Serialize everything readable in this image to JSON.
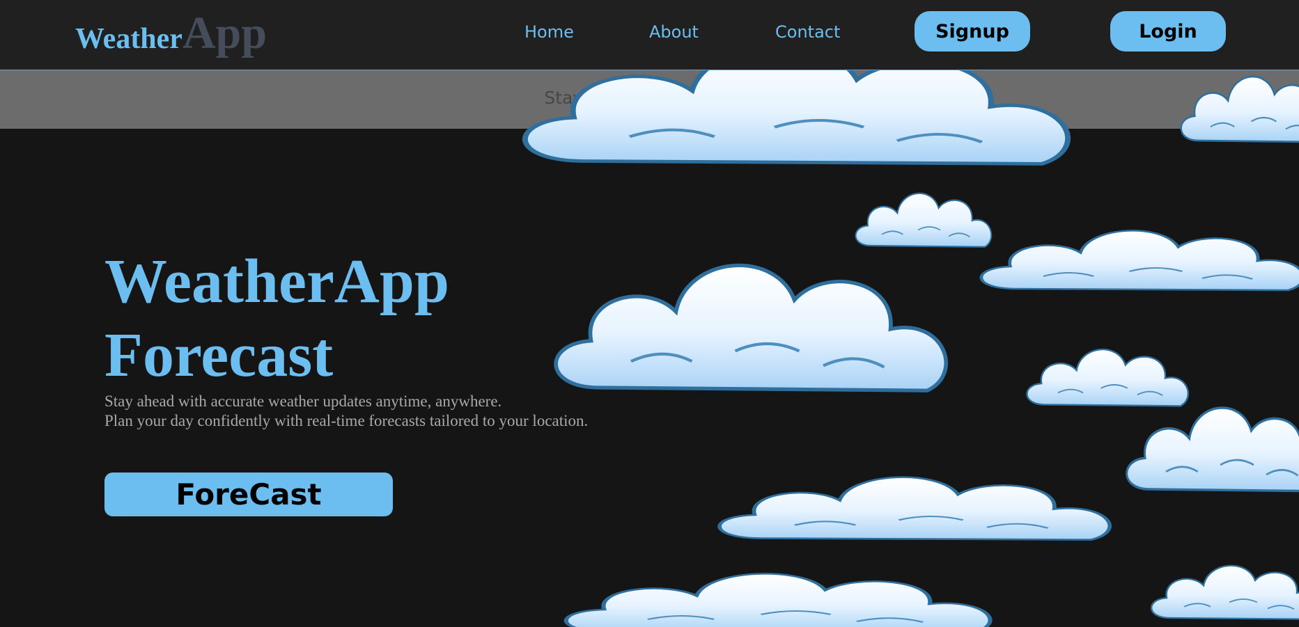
{
  "header": {
    "logo_first": "Weather",
    "logo_second": "App",
    "nav": [
      "Home",
      "About",
      "Contact"
    ],
    "signup_label": "Signup",
    "login_label": "Login"
  },
  "banner": {
    "text": "Stay Connected With Us"
  },
  "hero": {
    "title_line1": "WeatherApp",
    "title_line2": "Forecast",
    "subtitle_line1": "Stay ahead with accurate weather updates anytime, anywhere.",
    "subtitle_line2": "Plan your day confidently with real-time forecasts tailored to your location.",
    "button_label": "ForeCast"
  },
  "colors": {
    "accent": "#6cbdf0",
    "background": "#151515",
    "header": "#202020",
    "banner": "#6c6c6c"
  },
  "decor": {
    "background_image": "cartoon-clouds-illustration"
  }
}
